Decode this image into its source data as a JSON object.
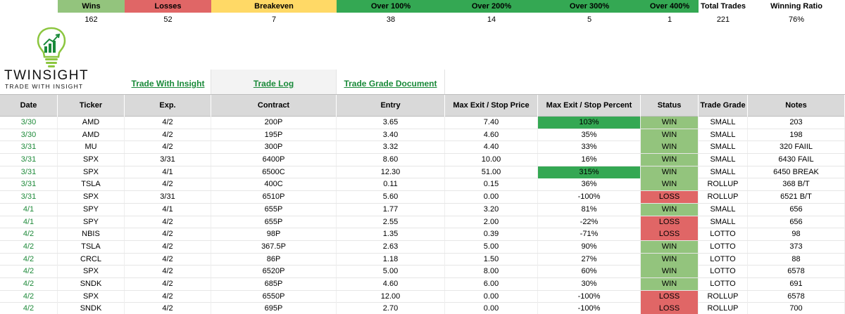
{
  "summary": {
    "headers": [
      "Wins",
      "Losses",
      "Breakeven",
      "Over 100%",
      "Over 200%",
      "Over 300%",
      "Over 400%",
      "Total Trades",
      "Winning Ratio"
    ],
    "values": [
      "162",
      "52",
      "7",
      "38",
      "14",
      "5",
      "1",
      "221",
      "76%"
    ],
    "colors": [
      "#93c47d",
      "#e06666",
      "#ffd966",
      "#34a853",
      "#34a853",
      "#34a853",
      "#34a853",
      "#ffffff",
      "#ffffff"
    ]
  },
  "brand": {
    "name": "TWINSIGHT",
    "tagline": "TRADE WITH INSIGHT",
    "icon": "lightbulb-chart-icon"
  },
  "links": [
    "Trade With Insight",
    "Trade Log",
    "Trade Grade Document"
  ],
  "table": {
    "columns": [
      "Date",
      "Ticker",
      "Exp.",
      "Contract",
      "Entry",
      "Max Exit / Stop Price",
      "Max Exit / Stop Percent",
      "Status",
      "Trade Grade",
      "Notes"
    ],
    "rows": [
      [
        "3/30",
        "AMD",
        "4/2",
        "200P",
        "3.65",
        "7.40",
        "103%",
        "WIN",
        "SMALL",
        "203"
      ],
      [
        "3/30",
        "AMD",
        "4/2",
        "195P",
        "3.40",
        "4.60",
        "35%",
        "WIN",
        "SMALL",
        "198"
      ],
      [
        "3/31",
        "MU",
        "4/2",
        "300P",
        "3.32",
        "4.40",
        "33%",
        "WIN",
        "SMALL",
        "320 FAIIL"
      ],
      [
        "3/31",
        "SPX",
        "3/31",
        "6400P",
        "8.60",
        "10.00",
        "16%",
        "WIN",
        "SMALL",
        "6430 FAIL"
      ],
      [
        "3/31",
        "SPX",
        "4/1",
        "6500C",
        "12.30",
        "51.00",
        "315%",
        "WIN",
        "SMALL",
        "6450 BREAK"
      ],
      [
        "3/31",
        "TSLA",
        "4/2",
        "400C",
        "0.11",
        "0.15",
        "36%",
        "WIN",
        "ROLLUP",
        "368 B/T"
      ],
      [
        "3/31",
        "SPX",
        "3/31",
        "6510P",
        "5.60",
        "0.00",
        "-100%",
        "LOSS",
        "ROLLUP",
        "6521 B/T"
      ],
      [
        "4/1",
        "SPY",
        "4/1",
        "655P",
        "1.77",
        "3.20",
        "81%",
        "WIN",
        "SMALL",
        "656"
      ],
      [
        "4/1",
        "SPY",
        "4/2",
        "655P",
        "2.55",
        "2.00",
        "-22%",
        "LOSS",
        "SMALL",
        "656"
      ],
      [
        "4/2",
        "NBIS",
        "4/2",
        "98P",
        "1.35",
        "0.39",
        "-71%",
        "LOSS",
        "LOTTO",
        "98"
      ],
      [
        "4/2",
        "TSLA",
        "4/2",
        "367.5P",
        "2.63",
        "5.00",
        "90%",
        "WIN",
        "LOTTO",
        "373"
      ],
      [
        "4/2",
        "CRCL",
        "4/2",
        "86P",
        "1.18",
        "1.50",
        "27%",
        "WIN",
        "LOTTO",
        "88"
      ],
      [
        "4/2",
        "SPX",
        "4/2",
        "6520P",
        "5.00",
        "8.00",
        "60%",
        "WIN",
        "LOTTO",
        "6578"
      ],
      [
        "4/2",
        "SNDK",
        "4/2",
        "685P",
        "4.60",
        "6.00",
        "30%",
        "WIN",
        "LOTTO",
        "691"
      ],
      [
        "4/2",
        "SPX",
        "4/2",
        "6550P",
        "12.00",
        "0.00",
        "-100%",
        "LOSS",
        "ROLLUP",
        "6578"
      ],
      [
        "4/2",
        "SNDK",
        "4/2",
        "695P",
        "2.70",
        "0.00",
        "-100%",
        "LOSS",
        "ROLLUP",
        "700"
      ]
    ]
  }
}
